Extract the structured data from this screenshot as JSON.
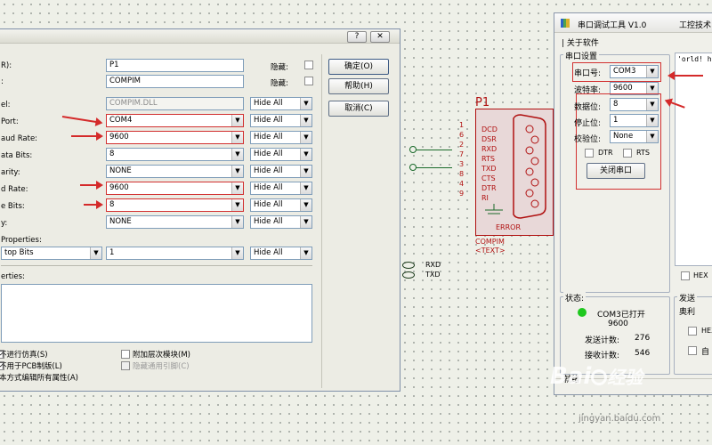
{
  "dialog": {
    "help_glyph": "?",
    "close_glyph": "✕",
    "rows": [
      {
        "label": "R):",
        "value": "P1",
        "hidden_label": "隐藏:"
      },
      {
        "label": ":",
        "value": "COMPIM",
        "hidden_label": "隐藏:"
      },
      {
        "label": "el:",
        "value": "COMPIM.DLL",
        "hide": "Hide All"
      },
      {
        "label": "Port:",
        "value": "COM4",
        "hide": "Hide All"
      },
      {
        "label": "aud Rate:",
        "value": "9600",
        "hide": "Hide All"
      },
      {
        "label": "ata Bits:",
        "value": "8",
        "hide": "Hide All"
      },
      {
        "label": "arity:",
        "value": "NONE",
        "hide": "Hide All"
      },
      {
        "label": "d Rate:",
        "value": "9600",
        "hide": "Hide All"
      },
      {
        "label": "e Bits:",
        "value": "8",
        "hide": "Hide All"
      },
      {
        "label": "y:",
        "value": "NONE",
        "hide": "Hide All"
      }
    ],
    "properties_label": "Properties:",
    "stop_bits": {
      "name": "top Bits",
      "value": "1",
      "hide": "Hide All"
    },
    "adv_properties_label": "erties:",
    "buttons": {
      "ok": "确定(O)",
      "help": "帮助(H)",
      "cancel": "取消(C)"
    },
    "options": {
      "no_sim": "不进行仿真(S)",
      "no_pcb": "不用于PCB制版(L)",
      "text_edit": "本方式编辑所有属性(A)",
      "hier_module": "附加层次模块(M)",
      "hide_pins": "隐藏通用引脚(C)"
    }
  },
  "component": {
    "ref": "P1",
    "name": "COMPIM",
    "text": "<TEXT>",
    "error": "ERROR",
    "pins": [
      {
        "num": "1",
        "name": "DCD"
      },
      {
        "num": "6",
        "name": "DSR"
      },
      {
        "num": "2",
        "name": "RXD"
      },
      {
        "num": "7",
        "name": "RTS"
      },
      {
        "num": "3",
        "name": "TXD"
      },
      {
        "num": "8",
        "name": "CTS"
      },
      {
        "num": "4",
        "name": "DTR"
      },
      {
        "num": "9",
        "name": "RI"
      }
    ]
  },
  "terminals": {
    "rxd": "RXD",
    "txd": "TXD"
  },
  "tool": {
    "title": "串口调试工具 V1.0",
    "title_right": "工控技术",
    "menu": "关于软件",
    "settings_title": "串口设置",
    "port_label": "串口号:",
    "port_value": "COM3",
    "baud_label": "波特率:",
    "baud_value": "9600",
    "data_label": "数据位:",
    "data_value": "8",
    "stop_label": "停止位:",
    "stop_value": "1",
    "parity_label": "校验位:",
    "parity_value": "None",
    "dtr": "DTR",
    "rts": "RTS",
    "close_button": "关闭串口",
    "recv_text": "'orld! h",
    "hex_label": "HEX",
    "status_title": "状态:",
    "status_line1": "COM3已打开",
    "status_line2": "9600",
    "sent_label": "发送计数:",
    "sent_value": "276",
    "recv_label": "接收计数:",
    "recv_value": "546",
    "send_title": "发送",
    "send_text": "奥利",
    "hex2": "HEX",
    "auto": "自",
    "footer": "就绪",
    "status_color": "#1fc81f"
  },
  "watermark": {
    "brand": "Bai",
    "brand2": "经验",
    "url": "jingyan.baidu.com"
  },
  "colors": {
    "red_highlight": "#d23030",
    "component_red": "#b01010",
    "component_fill": "#e8d8d8"
  }
}
